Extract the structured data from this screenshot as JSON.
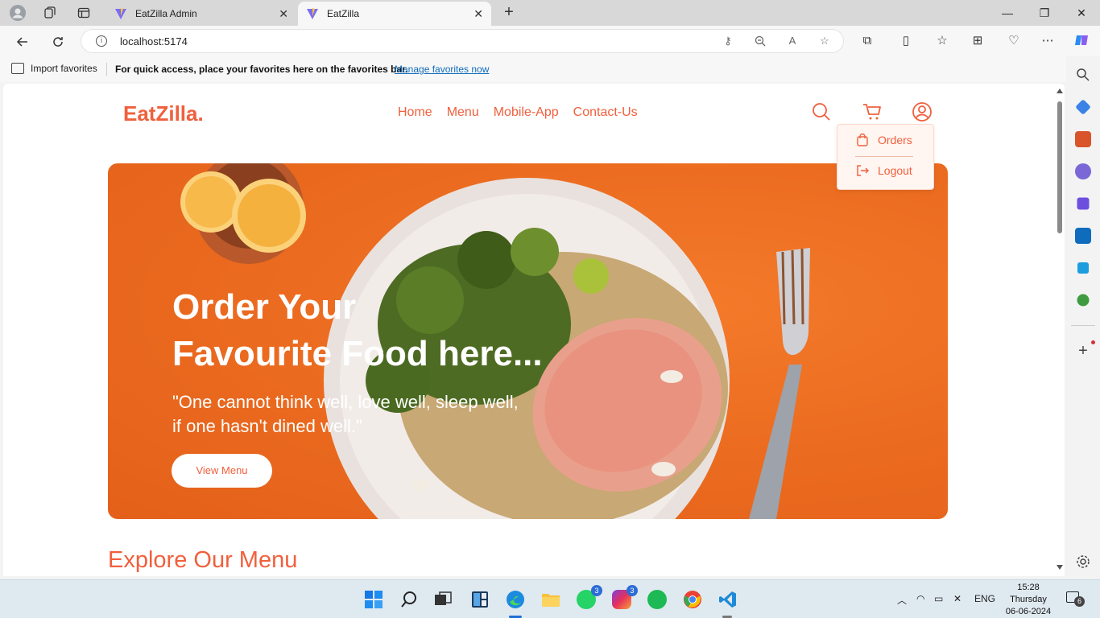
{
  "browser": {
    "tabs": [
      {
        "title": "EatZilla Admin"
      },
      {
        "title": "EatZilla"
      }
    ],
    "url": "localhost:5174",
    "favorites_bar": {
      "import_label": "Import favorites",
      "message": "For quick access, place your favorites here on the favorites bar.",
      "manage_link": "Manage favorites now"
    }
  },
  "site": {
    "logo": "EatZilla.",
    "nav": [
      "Home",
      "Menu",
      "Mobile-App",
      "Contact-Us"
    ],
    "profile_menu": {
      "orders": "Orders",
      "logout": "Logout"
    },
    "hero": {
      "title_line1": "Order Your",
      "title_line2": "Favourite Food here...",
      "quote_line1": "\"One cannot think well, love well, sleep well,",
      "quote_line2": "if one hasn't dined well.\"",
      "button": "View Menu"
    },
    "section_title": "Explore Our Menu"
  },
  "taskbar": {
    "whatsapp_badge": "3",
    "instagram_badge": "3",
    "language": "ENG",
    "time": "15:28",
    "day": "Thursday",
    "date": "06-06-2024",
    "notifications": "6"
  },
  "colors": {
    "brand": "#f0603d",
    "hero_bg": "#ea6a1f"
  }
}
